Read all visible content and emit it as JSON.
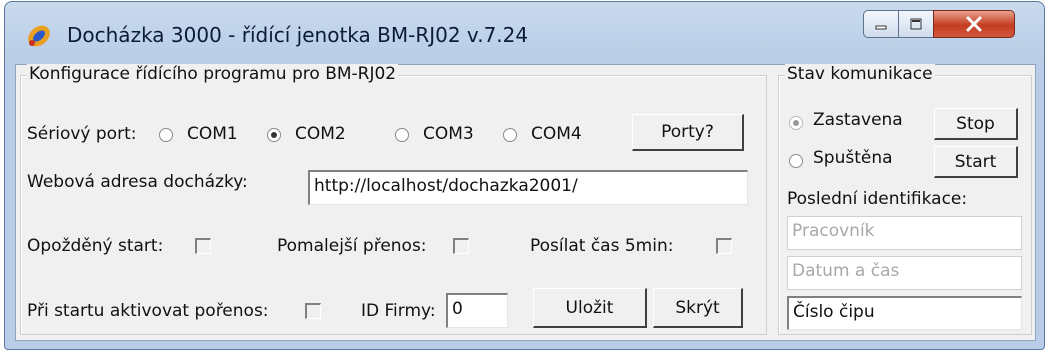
{
  "window": {
    "title": "Docházka 3000 - řídící jenotka BM-RJ02 v.7.24"
  },
  "config": {
    "legend": "Konfigurace řídícího programu pro BM-RJ02",
    "serial_label": "Sériový port:",
    "ports": [
      {
        "label": "COM1",
        "selected": false
      },
      {
        "label": "COM2",
        "selected": true
      },
      {
        "label": "COM3",
        "selected": false
      },
      {
        "label": "COM4",
        "selected": false
      }
    ],
    "ports_button": "Porty?",
    "web_label": "Webová adresa docházky:",
    "web_value": "http://localhost/dochazka2001/",
    "delayed_start_label": "Opožděný start:",
    "slow_transfer_label": "Pomalejší přenos:",
    "send_time_label": "Posílat čas 5min:",
    "activate_transfer_label": "Při startu aktivovat pořenos:",
    "firm_id_label": "ID Firmy:",
    "firm_id_value": "0",
    "save_button": "Uložit",
    "hide_button": "Skrýt"
  },
  "status": {
    "legend": "Stav komunikace",
    "stopped_label": "Zastavena",
    "stop_button": "Stop",
    "started_label": "Spuštěna",
    "start_button": "Start",
    "last_id_label": "Poslední identifikace:",
    "worker_placeholder": "Pracovník",
    "datetime_placeholder": "Datum a čas",
    "chip_value": "Číslo čipu"
  }
}
